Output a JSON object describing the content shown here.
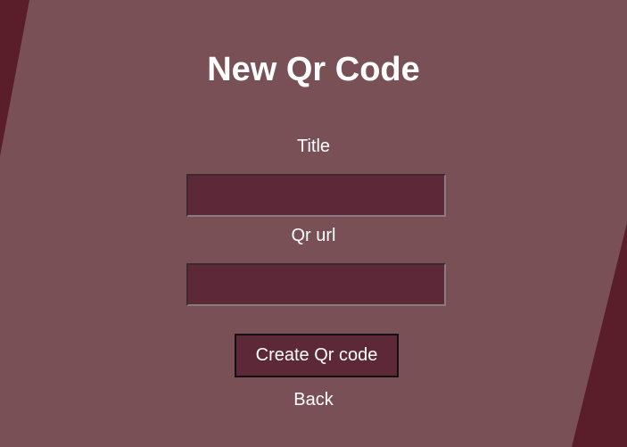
{
  "page": {
    "title": "New Qr Code"
  },
  "form": {
    "title_label": "Title",
    "title_value": "",
    "url_label": "Qr url",
    "url_value": "",
    "submit_label": "Create Qr code",
    "back_label": "Back"
  },
  "colors": {
    "background_dark": "#5a1e2b",
    "panel": "#7a5057",
    "input_fill": "#5d2838",
    "text": "#ffffff"
  }
}
